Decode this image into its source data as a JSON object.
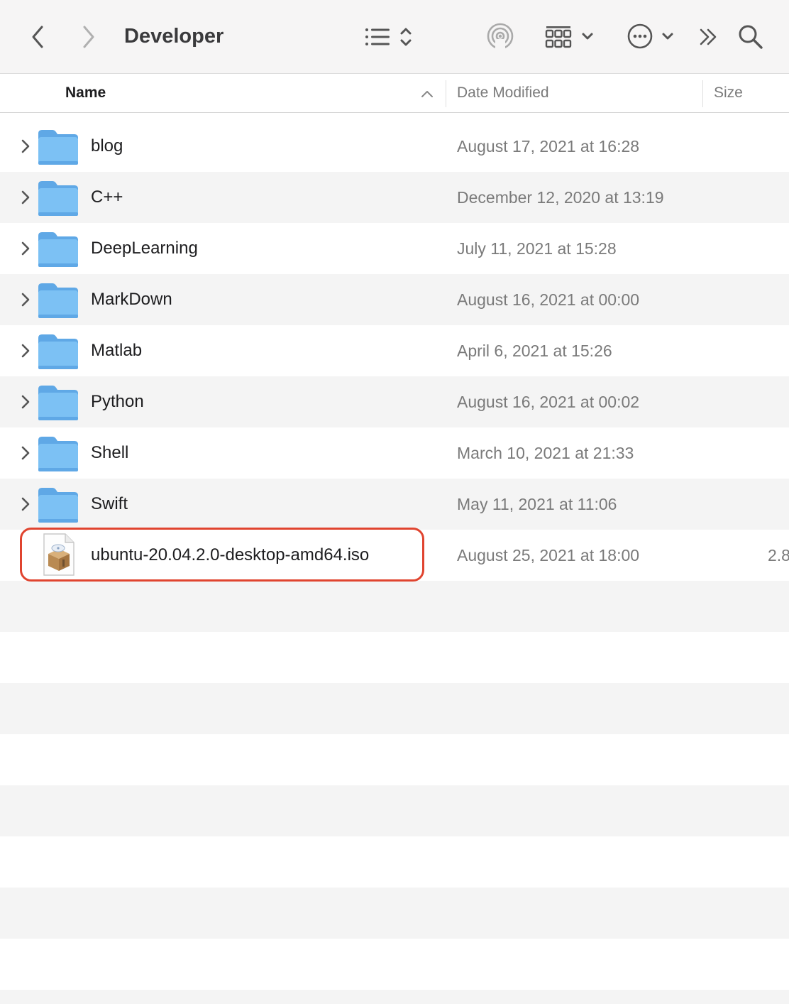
{
  "window": {
    "title": "Developer"
  },
  "toolbar": {
    "icons": [
      "back-chevron-icon",
      "forward-chevron-icon",
      "list-view-icon",
      "airdrop-icon",
      "group-grid-icon",
      "more-actions-icon",
      "overflow-chevron-icon",
      "search-icon"
    ]
  },
  "columns": {
    "name": "Name",
    "date_modified": "Date Modified",
    "size": "Size",
    "sort": "ascending"
  },
  "files": [
    {
      "name": "blog",
      "date": "August 17, 2021 at 16:28",
      "size": "",
      "kind": "folder"
    },
    {
      "name": "C++",
      "date": "December 12, 2020 at 13:19",
      "size": "",
      "kind": "folder"
    },
    {
      "name": "DeepLearning",
      "date": "July 11, 2021 at 15:28",
      "size": "",
      "kind": "folder"
    },
    {
      "name": "MarkDown",
      "date": "August 16, 2021 at 00:00",
      "size": "",
      "kind": "folder"
    },
    {
      "name": "Matlab",
      "date": "April 6, 2021 at 15:26",
      "size": "",
      "kind": "folder"
    },
    {
      "name": "Python",
      "date": "August 16, 2021 at 00:02",
      "size": "",
      "kind": "folder"
    },
    {
      "name": "Shell",
      "date": "March 10, 2021 at 21:33",
      "size": "",
      "kind": "folder"
    },
    {
      "name": "Swift",
      "date": "May 11, 2021 at 11:06",
      "size": "",
      "kind": "folder"
    },
    {
      "name": "ubuntu-20.04.2.0-desktop-amd64.iso",
      "date": "August 25, 2021 at 18:00",
      "size": "2.8",
      "kind": "disk-image",
      "highlighted": true
    }
  ],
  "colors": {
    "folder_blue": "#7cc1f4",
    "highlight_red": "#e0442f",
    "row_alt": "#f4f4f4",
    "toolbar_bg": "#f6f5f5"
  }
}
